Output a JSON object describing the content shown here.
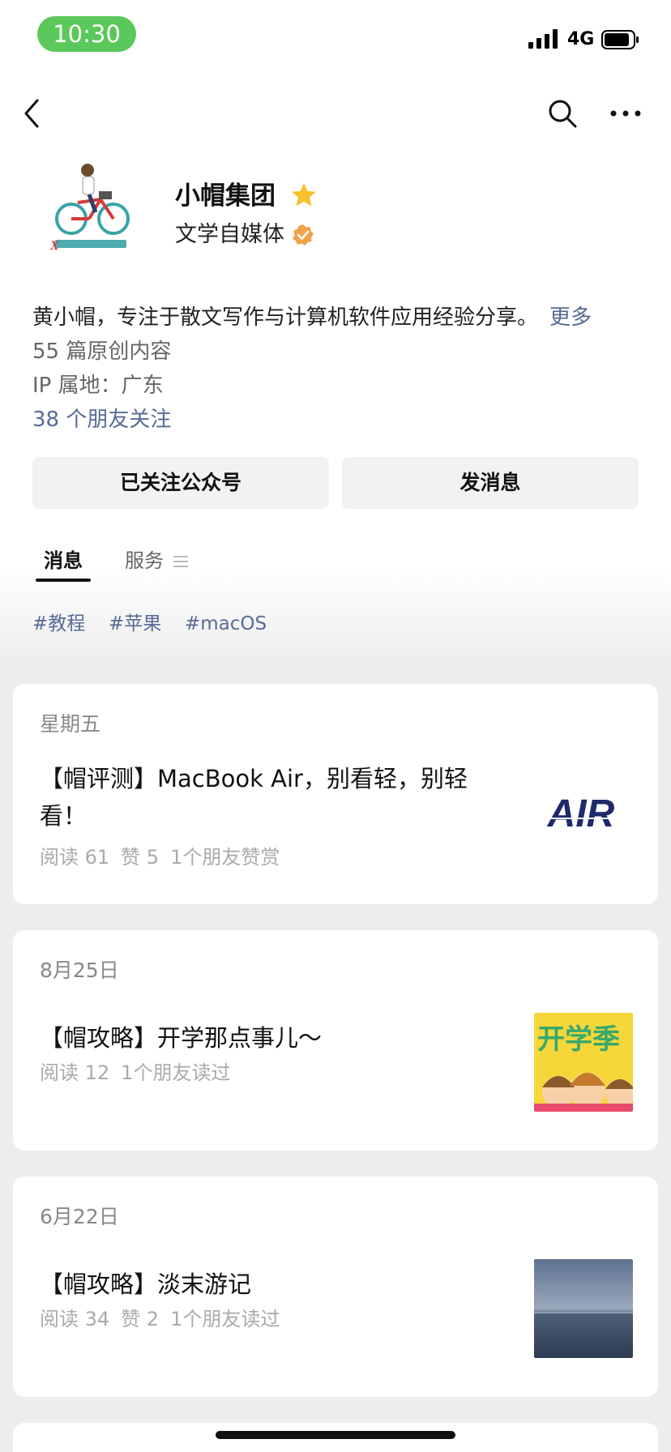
{
  "status_bar": {
    "time": "10:30",
    "network": "4G",
    "accent": "#5ac85a"
  },
  "nav": {
    "back_icon": "chevron-left-icon",
    "search_icon": "search-icon",
    "more_icon": "ellipsis-icon"
  },
  "profile": {
    "name": "小帽集团",
    "subtitle": "文学自媒体",
    "bio": "黄小帽，专注于散文写作与计算机软件应用经验分享。",
    "bio_more": "更多",
    "original_count": "55 篇原创内容",
    "ip_location": "IP 属地：广东",
    "friends_following": "38 个朋友关注",
    "star_color": "#f7c12b",
    "verified_color": "#f0a24a"
  },
  "actions": {
    "follow": "已关注公众号",
    "message": "发消息"
  },
  "tabs": [
    {
      "label": "消息",
      "active": true
    },
    {
      "label": "服务",
      "active": false
    }
  ],
  "tags": [
    "#教程",
    "#苹果",
    "#macOS"
  ],
  "articles": [
    {
      "date": "星期五",
      "title": "【帽评测】MacBook Air，别看轻，别轻看！",
      "meta": [
        "阅读 61",
        "赞 5",
        "1个朋友赞赏"
      ],
      "thumb": "AIR"
    },
    {
      "date": "8月25日",
      "title": "【帽攻略】开学那点事儿～",
      "meta": [
        "阅读 12",
        "1个朋友读过"
      ],
      "thumb": "开学季"
    },
    {
      "date": "6月22日",
      "title": "【帽攻略】淡末游记",
      "meta": [
        "阅读 34",
        "赞 2",
        "1个朋友读过"
      ],
      "thumb": ""
    }
  ],
  "link_color": "#576b95"
}
